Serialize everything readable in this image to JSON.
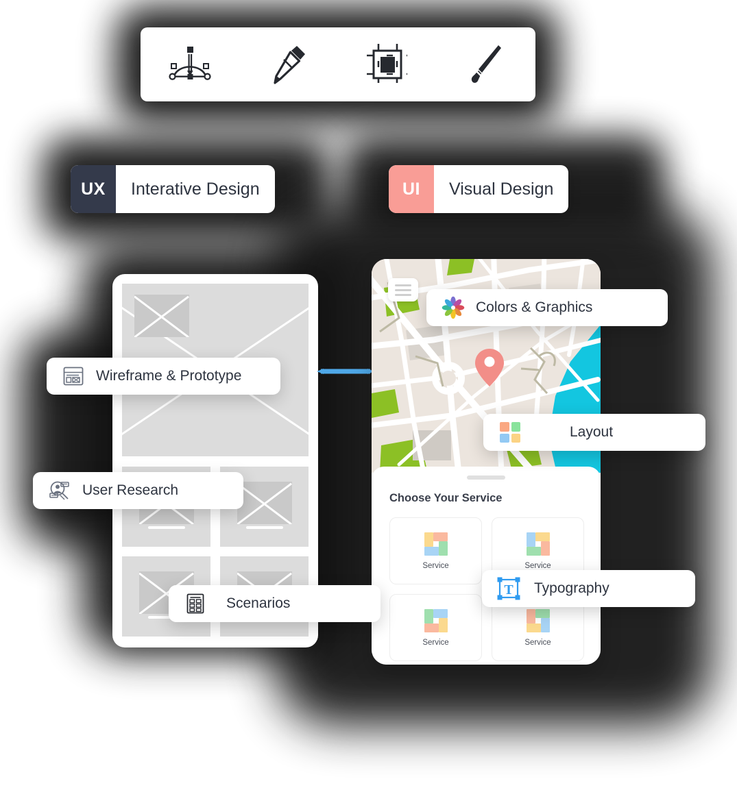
{
  "toolbar": {
    "tools": [
      {
        "name": "pen-tool-icon",
        "label": "Pen Tool"
      },
      {
        "name": "pencil-icon",
        "label": "Pencil"
      },
      {
        "name": "artboard-icon",
        "label": "Artboard"
      },
      {
        "name": "paintbrush-icon",
        "label": "Paintbrush"
      }
    ]
  },
  "chips": [
    {
      "badge": "UX",
      "label": "Interative Design",
      "color": "#343A4B"
    },
    {
      "badge": "UI",
      "label": "Visual Design",
      "color": "#F99D96"
    }
  ],
  "labels": {
    "wireframe": "Wireframe & Prototype",
    "research": "User Research",
    "scenarios": "Scenarios",
    "colors": "Colors & Graphics",
    "layout": "Layout",
    "typography": "Typography"
  },
  "icons": {
    "wireframe": "wireframe-icon",
    "research": "user-research-icon",
    "scenarios": "scenarios-grid-icon",
    "colors": "color-flower-icon",
    "layout": "layout-squares-icon",
    "typography": "typography-t-icon",
    "menu": "hamburger-menu-icon",
    "pin": "map-pin-icon"
  },
  "phone": {
    "sheet_title": "Choose Your Service",
    "services": [
      {
        "label": "Service"
      },
      {
        "label": "Service"
      },
      {
        "label": "Service"
      },
      {
        "label": "Service"
      }
    ]
  },
  "palette": {
    "ux_badge": "#343A4B",
    "ui_badge": "#F99D96",
    "connector": "#4FA8E8",
    "map_land": "#ECE5DE",
    "map_road": "#FFFFFF",
    "map_park": "#8CC025",
    "map_water": "#13C6E0",
    "map_pin": "#F28E88",
    "wire_gray": "#DCDCDC",
    "typography_blue": "#2F9BF0",
    "pastel_salmon": "#FAB99F",
    "pastel_green": "#9FDFAE",
    "pastel_blue": "#A8D4F5",
    "pastel_yellow": "#FBD98E"
  }
}
